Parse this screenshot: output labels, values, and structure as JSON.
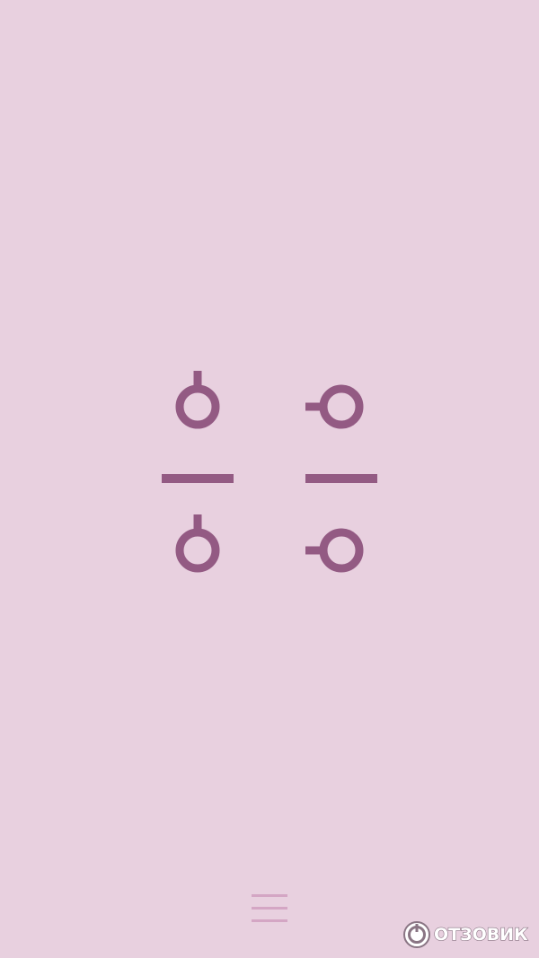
{
  "theme": {
    "background": "#e8d0df",
    "tile_color": "#935a83",
    "menu_color": "#d4a6c4"
  },
  "tiles": [
    {
      "type": "connector",
      "opening": "up",
      "col": 0,
      "row": 0
    },
    {
      "type": "connector",
      "opening": "left",
      "col": 1,
      "row": 0
    },
    {
      "type": "bar",
      "orientation": "horizontal",
      "col": 0,
      "row": 1
    },
    {
      "type": "bar",
      "orientation": "horizontal",
      "col": 1,
      "row": 1
    },
    {
      "type": "connector",
      "opening": "up",
      "col": 0,
      "row": 2
    },
    {
      "type": "connector",
      "opening": "left",
      "col": 1,
      "row": 2
    }
  ],
  "menu": {
    "icon": "hamburger-menu-icon"
  },
  "watermark": {
    "text": "ОТЗОВИК",
    "logo": "otzovik-logo"
  }
}
